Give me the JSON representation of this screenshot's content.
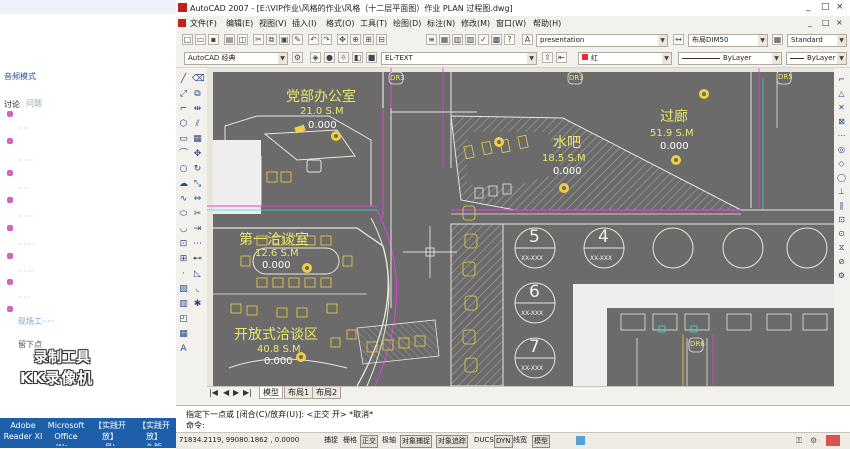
{
  "left_panel": {
    "mode_label": "音频模式",
    "tab_discuss": "讨论",
    "tab_other": "问题",
    "ghost_rows": [
      "····",
      "······",
      "····",
      "······",
      "·······",
      "······",
      "·····",
      "········"
    ],
    "blue_row": "现场工·····",
    "bottom_label": "留下点",
    "watermark_line1": "录制工具",
    "watermark_line2": "KK录像机"
  },
  "taskbar": {
    "items": [
      {
        "line1": "Adobe",
        "line2": "Reader XI"
      },
      {
        "line1": "Microsoft",
        "line2": "Office Wo..."
      },
      {
        "line1": "【实践开放】",
        "line2": "月)"
      },
      {
        "line1": "【实践开放】",
        "line2": "久版"
      }
    ]
  },
  "window": {
    "title": "AutoCAD 2007 - [E:\\VIP作业\\风格的作业\\风格（十二层平面图）作业 PLAN 过程图.dwg]",
    "min_glyph": "_",
    "max_glyph": "□",
    "close_glyph": "×"
  },
  "menu": {
    "items": [
      "文件(F)",
      "编辑(E)",
      "视图(V)",
      "插入(I)",
      "格式(O)",
      "工具(T)",
      "绘图(D)",
      "标注(N)",
      "修改(M)",
      "窗口(W)",
      "帮助(H)"
    ]
  },
  "toolbar": {
    "text_style": "presentation",
    "dim_style": "布局DIM50",
    "table_style": "Standard",
    "workspace": "AutoCAD 经典",
    "layer": "EL-TEXT",
    "color": "红",
    "linetype": "ByLayer",
    "lineweight": "ByLayer",
    "plotstyle": "ByLayer"
  },
  "drawing": {
    "rooms": [
      {
        "name": "党部办公室",
        "area": "21.0  S.M",
        "num": "0.000"
      },
      {
        "name": "水吧",
        "area": "18.5  S.M",
        "num": "0.000"
      },
      {
        "name": "过廊",
        "area": "51.9  S.M",
        "num": "0.000"
      },
      {
        "name": "第一洽谈室",
        "area": "12.6  S.M",
        "num": "0.000"
      },
      {
        "name": "开放式洽谈区",
        "area": "40.8  S.M",
        "num": "0.000"
      }
    ],
    "zones": [
      {
        "num": "5",
        "code": "XX-XXX"
      },
      {
        "num": "4",
        "code": "XX-XXX"
      },
      {
        "num": "6",
        "code": "XX-XXX"
      },
      {
        "num": "7",
        "code": "XX-XXX"
      }
    ],
    "tags": [
      "DR3",
      "DR3",
      "DR5",
      "DR6"
    ]
  },
  "layout_tabs": {
    "nav": [
      "|◀",
      "◀",
      "▶",
      "▶|"
    ],
    "tabs": [
      "模型",
      "布局1",
      "布局2"
    ]
  },
  "command": {
    "line1": "指定下一点或 [闭合(C)/放弃(U)]:  <正交 开> *取消*",
    "line2": "命令:"
  },
  "status": {
    "coords": "71834.2119, 99080.1862 , 0.0000",
    "buttons": [
      "捕捉",
      "栅格",
      "正交",
      "极轴",
      "对象捕捉",
      "对象追踪",
      "DUCS",
      "DYN",
      "线宽",
      "模型"
    ]
  },
  "colors": {
    "canvas": "#6b6b6b",
    "wall": "#e8e6dc",
    "annotation": "#e8e868",
    "magenta": "#e040e0",
    "cyan": "#40d8e8",
    "window_chrome": "#f3f1ec"
  }
}
